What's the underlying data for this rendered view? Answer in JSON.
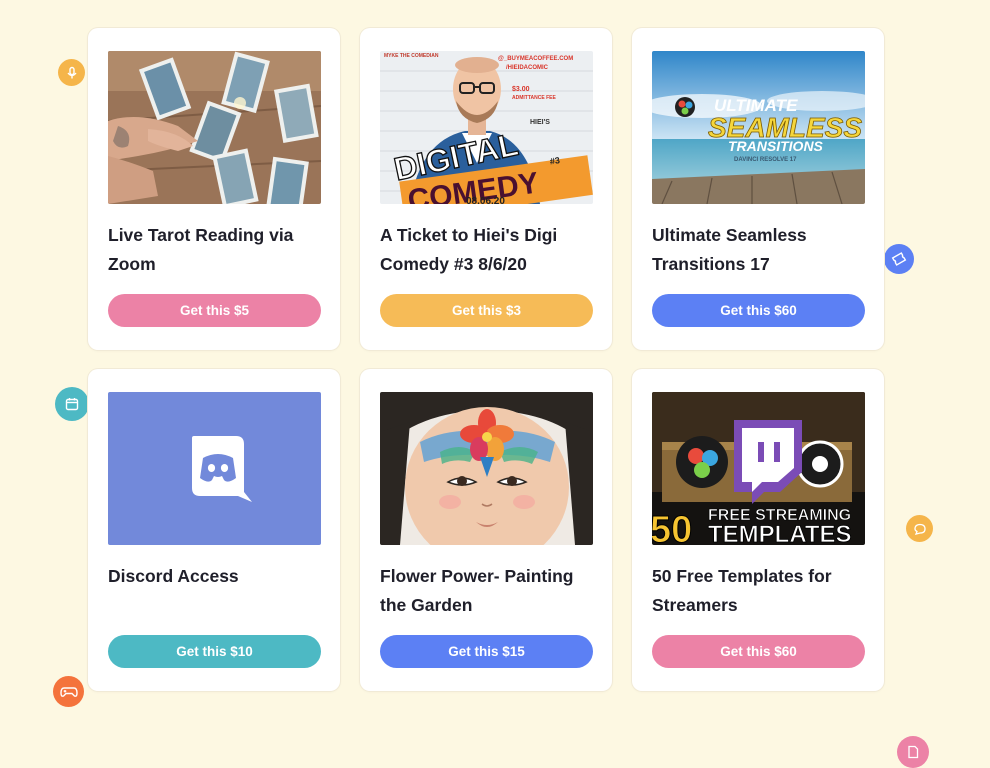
{
  "products": [
    {
      "title": "Live Tarot Reading via Zoom",
      "button_label": "Get this $5"
    },
    {
      "title": "A Ticket to Hiei's Digi Comedy #3 8/6/20",
      "button_label": "Get this $3"
    },
    {
      "title": "Ultimate Seamless Transitions 17",
      "button_label": "Get this $60"
    },
    {
      "title": "Discord Access",
      "button_label": "Get this $10"
    },
    {
      "title": "Flower Power- Painting the Garden",
      "button_label": "Get this $15"
    },
    {
      "title": "50 Free Templates for Streamers",
      "button_label": "Get this $60"
    }
  ],
  "thumbnails": {
    "comedy": {
      "top_lines": [
        "MYKE THE COMEDIAN",
        "@_BUYMEACOFFEE.COM",
        "/HIEIDACOMIC"
      ],
      "fee": "$3.00",
      "fee_label": "ADMITTANCE FEE",
      "host": "HIEI'S",
      "digital": "DIGITAL",
      "comedy": "COMEDY",
      "number": "#3",
      "date": "08.06.20"
    },
    "transitions": {
      "line1": "ULTIMATE",
      "line2": "SEAMLESS",
      "line3": "TRANSITIONS",
      "subtitle": "DAVINCI RESOLVE 17"
    },
    "streaming": {
      "number": "50",
      "line1": "FREE STREAMING",
      "line2": "TEMPLATES"
    }
  },
  "colors": {
    "background": "#fdf8e2",
    "pink": "#ec82a6",
    "yellow": "#f6bb57",
    "blue": "#5c80f4",
    "teal": "#4db9c4",
    "discord": "#7289da"
  },
  "decorative_icons": [
    "microphone-icon",
    "ticket-icon",
    "calendar-icon",
    "speech-bubble-icon",
    "gamepad-icon",
    "document-icon"
  ]
}
